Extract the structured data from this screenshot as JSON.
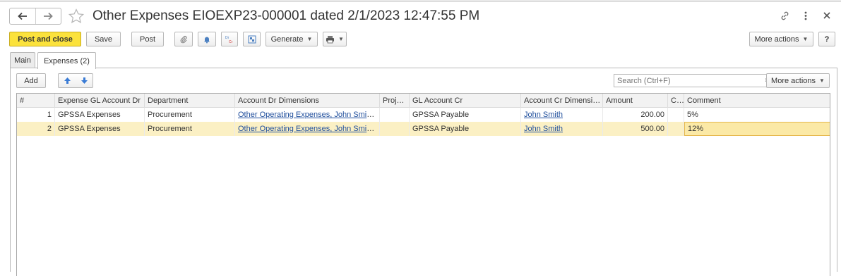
{
  "window": {
    "title": "Other Expenses EIOEXP23-000001 dated 2/1/2023 12:47:55 PM"
  },
  "toolbar": {
    "post_and_close": "Post and close",
    "save": "Save",
    "post": "Post",
    "generate": "Generate",
    "more_actions": "More actions",
    "help": "?"
  },
  "tabs": [
    {
      "label": "Main"
    },
    {
      "label": "Expenses (2)"
    }
  ],
  "panel": {
    "add": "Add",
    "search_placeholder": "Search (Ctrl+F)",
    "clear": "×",
    "more_actions": "More actions"
  },
  "grid": {
    "columns": [
      "#",
      "Expense GL Account Dr",
      "Department",
      "Account Dr Dimensions",
      "Proj…",
      "GL Account Cr",
      "Account Cr Dimensi…",
      "Amount",
      "C…",
      "Comment"
    ],
    "rows": [
      {
        "n": "1",
        "gl_dr": "GPSSA Expenses",
        "dept": "Procurement",
        "dr_dims": "Other Operating Expenses, John Smit…",
        "proj": "",
        "gl_cr": "GPSSA Payable",
        "cr_dims": "John Smith",
        "amount": "200.00",
        "c": "",
        "comment": "5%"
      },
      {
        "n": "2",
        "gl_dr": "GPSSA Expenses",
        "dept": "Procurement",
        "dr_dims": "Other Operating Expenses, John Smit…",
        "proj": "",
        "gl_cr": "GPSSA Payable",
        "cr_dims": "John Smith",
        "amount": "500.00",
        "c": "",
        "comment": "12%"
      }
    ]
  },
  "colors": {
    "primary_button": "#fbe23c",
    "selected_row": "#fbf0c4",
    "link": "#1f4e9c"
  },
  "icons": [
    "arrow-left-icon",
    "arrow-right-icon",
    "star-icon",
    "link-icon",
    "kebab-icon",
    "close-icon",
    "paperclip-icon",
    "bell-icon",
    "dr-cr-icon",
    "structure-icon",
    "print-icon",
    "move-up-icon",
    "move-down-icon"
  ]
}
